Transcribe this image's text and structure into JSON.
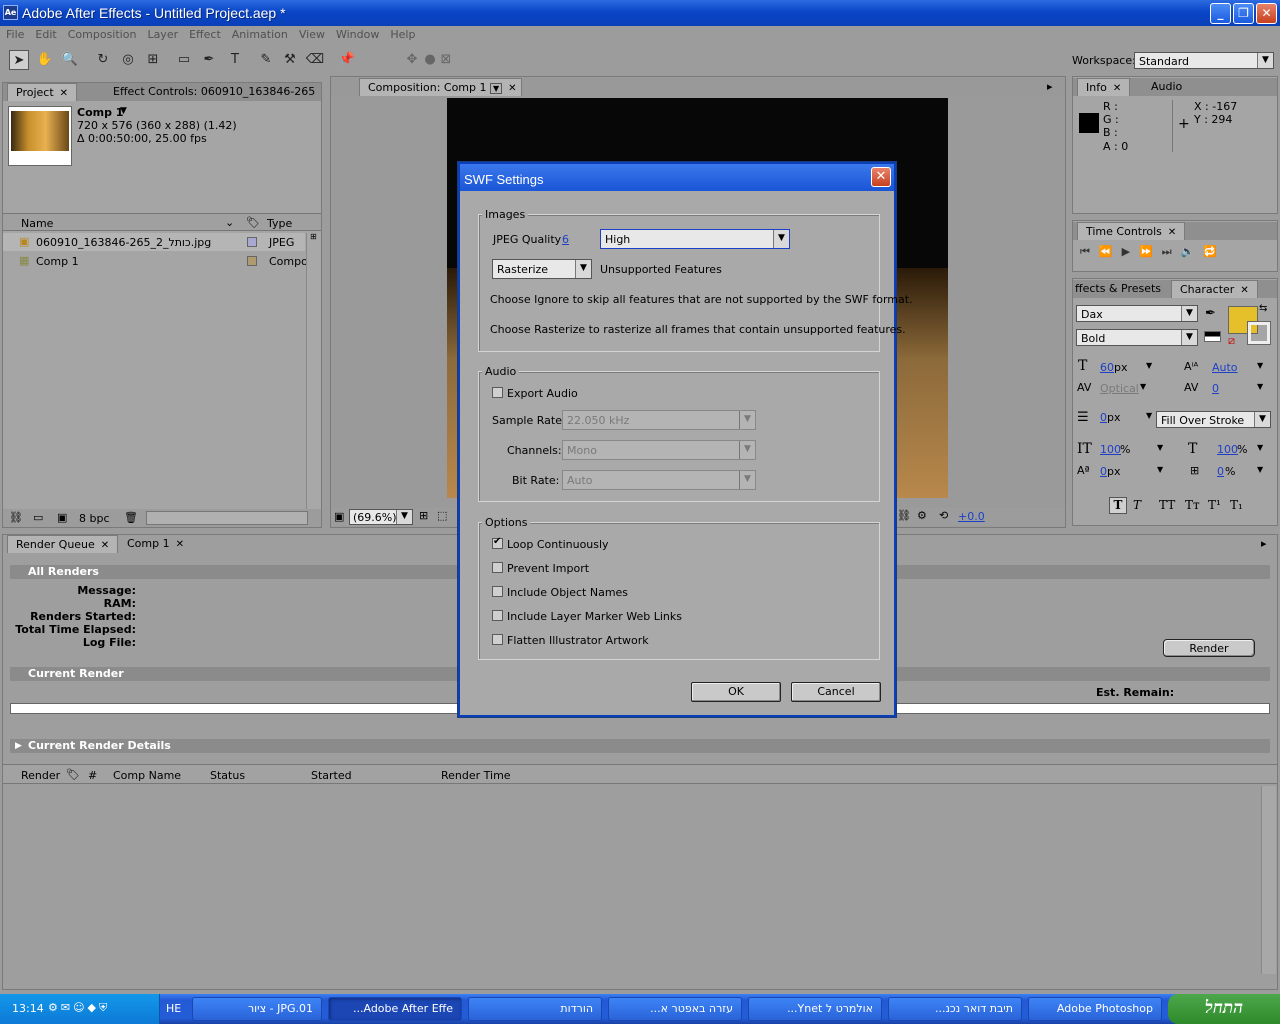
{
  "window": {
    "title": "Adobe After Effects - Untitled Project.aep *",
    "app_icon": "Ae"
  },
  "menu": [
    "File",
    "Edit",
    "Composition",
    "Layer",
    "Effect",
    "Animation",
    "View",
    "Window",
    "Help"
  ],
  "workspace": {
    "label": "Workspace:",
    "value": "Standard"
  },
  "project_panel": {
    "tab_project": "Project",
    "tab_effect_controls": "Effect Controls: 060910_163846-265",
    "comp_name": "Comp 1",
    "comp_size": "720 x 576  (360 x 288) (1.42)",
    "comp_duration": "Δ 0:00:50:00, 25.00 fps",
    "col_name": "Name",
    "col_type": "Type",
    "items": [
      {
        "name": "060910_163846-265_2_כותל.jpg",
        "type": "JPEG",
        "color": "#a8a8d0"
      },
      {
        "name": "Comp 1",
        "type": "Compos",
        "color": "#b09a70"
      }
    ],
    "bpc": "8 bpc"
  },
  "composition_panel": {
    "tab": "Composition: Comp 1",
    "zoom": "(69.6%)",
    "exposure": "+0.0"
  },
  "info_panel": {
    "tab_info": "Info",
    "tab_audio": "Audio",
    "r": "R :",
    "g": "G :",
    "b": "B :",
    "a": "A : 0",
    "x": "X : -167",
    "y": "Y : 294"
  },
  "time_controls": {
    "tab": "Time Controls"
  },
  "character_panel": {
    "tab_effects": "ffects & Presets",
    "tab_character": "Character",
    "font": "Dax",
    "style": "Bold",
    "size": "60",
    "size_unit": "px",
    "leading": "Auto",
    "kerning": "Optical",
    "tracking": "0",
    "stroke_width": "0",
    "stroke_unit": "px",
    "stroke_mode": "Fill Over Stroke",
    "vscale": "100",
    "hscale": "100",
    "pct": "%",
    "baseline": "0",
    "baseline_unit": "px",
    "tsume": "0",
    "fill_color": "#e6c02a",
    "format_buttons": [
      "T",
      "T",
      "TT",
      "Tт",
      "T¹",
      "T₁"
    ]
  },
  "render_queue": {
    "tab_render_queue": "Render Queue",
    "tab_comp": "Comp 1",
    "all_renders": "All Renders",
    "fields": [
      "Message:",
      "RAM:",
      "Renders Started:",
      "Total Time Elapsed:",
      "Log File:"
    ],
    "render_button": "Render",
    "current_render": "Current Render",
    "est_remain": "Est. Remain:",
    "current_render_details": "Current Render Details",
    "columns": [
      "Render",
      "#",
      "Comp Name",
      "Status",
      "Started",
      "Render Time"
    ]
  },
  "swf_dialog": {
    "title": "SWF Settings",
    "images_group": "Images",
    "jpeg_quality_label": "JPEG Quality",
    "jpeg_quality_value": "6",
    "jpeg_quality_preset": "High",
    "unsupported_mode": "Rasterize",
    "unsupported_label": "Unsupported Features",
    "help_ignore": "Choose Ignore to skip all features that are not supported by the SWF format.",
    "help_rasterize": "Choose Rasterize to rasterize all frames that contain unsupported features.",
    "audio_group": "Audio",
    "export_audio": "Export Audio",
    "sample_rate_label": "Sample Rate:",
    "sample_rate_value": "22.050 kHz",
    "channels_label": "Channels:",
    "channels_value": "Mono",
    "bit_rate_label": "Bit Rate:",
    "bit_rate_value": "Auto",
    "options_group": "Options",
    "options": [
      {
        "label": "Loop Continuously",
        "checked": true
      },
      {
        "label": "Prevent Import",
        "checked": false
      },
      {
        "label": "Include Object Names",
        "checked": false
      },
      {
        "label": "Include Layer Marker Web Links",
        "checked": false
      },
      {
        "label": "Flatten Illustrator Artwork",
        "checked": false
      }
    ],
    "ok": "OK",
    "cancel": "Cancel"
  },
  "taskbar": {
    "start": "התחל",
    "clock": "13:14",
    "lang": "HE",
    "buttons": [
      "ציור - JPG.01",
      "...Adobe After Effe",
      "הורדות",
      "...עזרה באפטר א",
      "...Ynet אולמרט ל",
      "...תיבת דואר נכנ",
      "Adobe Photoshop"
    ]
  }
}
